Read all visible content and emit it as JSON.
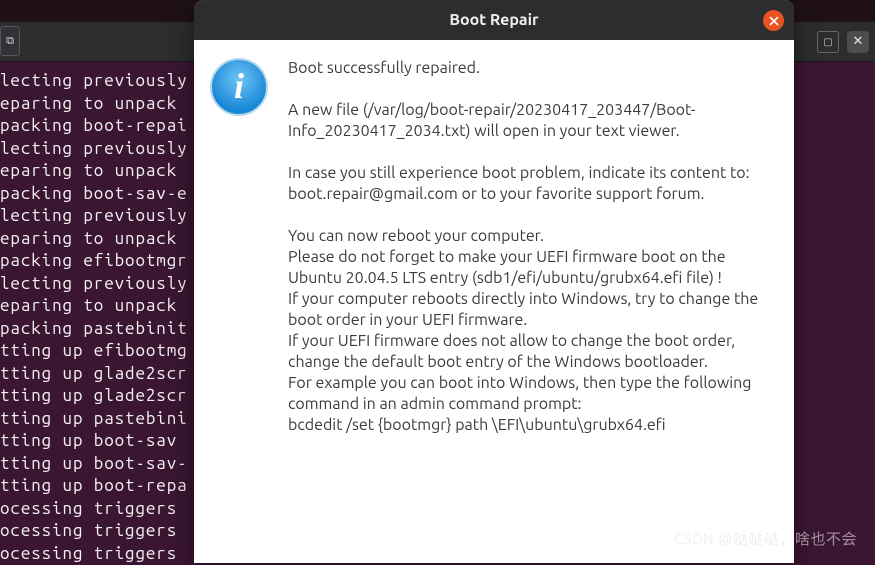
{
  "toolbar": {
    "newtab_glyph": "⧉"
  },
  "terminal": {
    "lines": [
      "lecting previously",
      "eparing to unpack ",
      "packing boot-repai",
      "lecting previously",
      "eparing to unpack ",
      "packing boot-sav-e",
      "lecting previously",
      "eparing to unpack ",
      "packing efibootmgr",
      "lecting previously",
      "eparing to unpack ",
      "packing pastebinit",
      "tting up efibootmg",
      "tting up glade2scr",
      "tting up glade2scr",
      "tting up pastebini",
      "tting up boot-sav ",
      "tting up boot-sav-",
      "tting up boot-repa",
      "ocessing triggers ",
      "ocessing triggers ",
      "ocessing triggers "
    ]
  },
  "dialog": {
    "title": "Boot Repair",
    "line1": "Boot successfully repaired.",
    "line2": "A new file (/var/log/boot-repair/20230417_203447/Boot-Info_20230417_2034.txt) will open in your text viewer.",
    "line3a": "In case you still experience boot problem, indicate its content to:",
    "line3b": "boot.repair@gmail.com or to your favorite support forum.",
    "line4a": "You can now reboot your computer.",
    "line4b": "Please do not forget to make your UEFI firmware boot on the Ubuntu 20.04.5 LTS entry (sdb1/efi/ubuntu/grubx64.efi file) !",
    "line4c": "If your computer reboots directly into Windows, try to change the boot order in your UEFI firmware.",
    "line4d": "If your UEFI firmware does not allow to change the boot order, change the default boot entry of the Windows bootloader.",
    "line4e": "For example you can boot into Windows, then type the following command in an admin command prompt:",
    "line4f": "bcdedit /set {bootmgr} path \\EFI\\ubuntu\\grubx64.efi"
  },
  "watermark": "CSDN @哒哒哒，啥也不会"
}
